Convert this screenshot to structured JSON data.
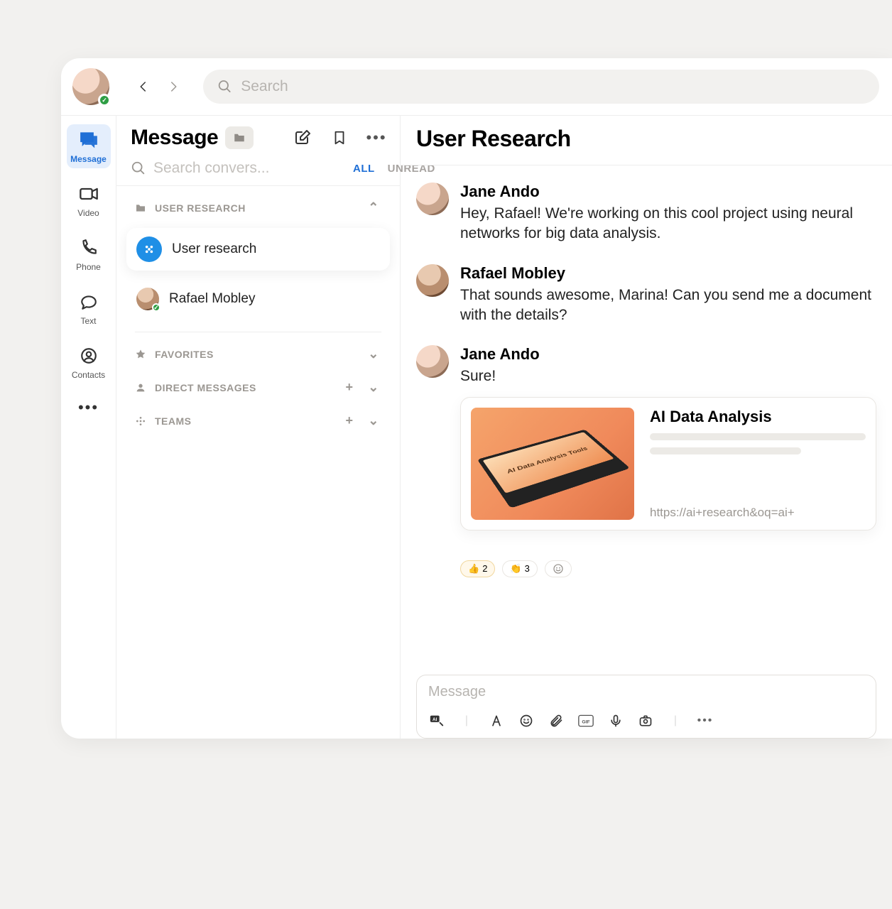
{
  "topbar": {
    "search_placeholder": "Search"
  },
  "rail": {
    "items": [
      {
        "label": "Message",
        "icon": "message-icon",
        "active": true
      },
      {
        "label": "Video",
        "icon": "video-icon",
        "active": false
      },
      {
        "label": "Phone",
        "icon": "phone-icon",
        "active": false
      },
      {
        "label": "Text",
        "icon": "text-icon",
        "active": false
      },
      {
        "label": "Contacts",
        "icon": "contacts-icon",
        "active": false
      }
    ]
  },
  "convo": {
    "title": "Message",
    "search_placeholder": "Search convers...",
    "filters": {
      "all": "ALL",
      "unread": "UNREAD"
    },
    "sections": {
      "user_research": {
        "label": "USER RESEARCH",
        "items": [
          {
            "label": "User research",
            "icon": "channel",
            "active": true
          },
          {
            "label": "Rafael Mobley",
            "icon": "avatar",
            "active": false
          }
        ]
      },
      "favorites": {
        "label": "FAVORITES"
      },
      "direct_messages": {
        "label": "DIRECT MESSAGES"
      },
      "teams": {
        "label": "TEAMS"
      }
    }
  },
  "chat": {
    "title": "User Research",
    "messages": [
      {
        "author": "Jane Ando",
        "text": "Hey, Rafael! We're working on this cool project using neural networks for big data analysis."
      },
      {
        "author": "Rafael Mobley",
        "text": "That sounds awesome, Marina! Can you send me a document with the details?"
      },
      {
        "author": "Jane Ando",
        "text": "Sure!",
        "attachment": {
          "thumb_text": "AI Data Analysis Tools",
          "title": "AI Data Analysis",
          "url": "https://ai+research&oq=ai+"
        },
        "reactions": [
          {
            "emoji": "👍",
            "count": 2
          },
          {
            "emoji": "👏",
            "count": 3
          }
        ]
      }
    ],
    "composer_placeholder": "Message"
  }
}
